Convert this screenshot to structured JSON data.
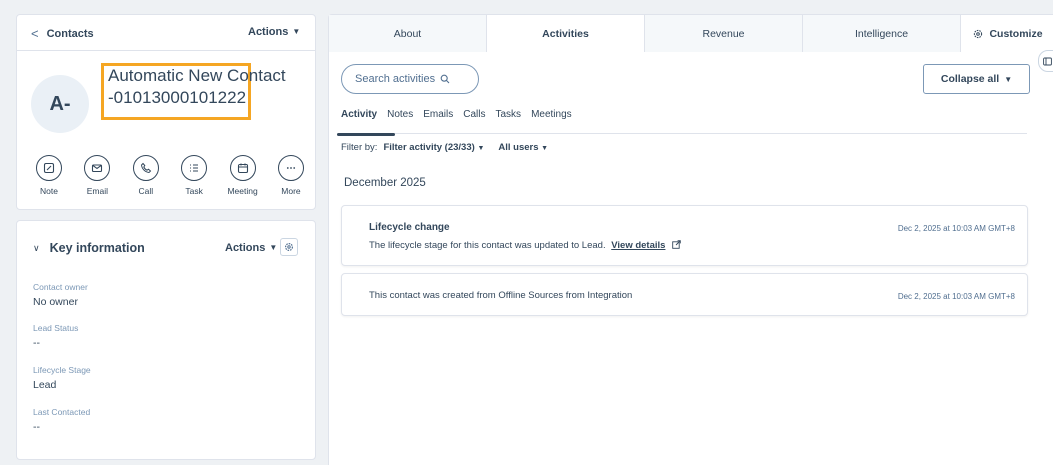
{
  "contact_card": {
    "back_label": "Contacts",
    "actions_label": "Actions",
    "avatar_initials": "A-",
    "name": "Automatic New Contact -01013000101222",
    "quick_actions": [
      "Note",
      "Email",
      "Call",
      "Task",
      "Meeting",
      "More"
    ]
  },
  "key_info": {
    "title": "Key information",
    "actions_label": "Actions",
    "properties": [
      {
        "label": "Contact owner",
        "value": "No owner"
      },
      {
        "label": "Lead Status",
        "value": "--"
      },
      {
        "label": "Lifecycle Stage",
        "value": "Lead"
      },
      {
        "label": "Last Contacted",
        "value": "--"
      }
    ]
  },
  "tabs": [
    "About",
    "Activities",
    "Revenue",
    "Intelligence"
  ],
  "customize_label": "Customize",
  "activities": {
    "search_placeholder": "Search activities",
    "collapse_label": "Collapse all",
    "subtabs": [
      "Activity",
      "Notes",
      "Emails",
      "Calls",
      "Tasks",
      "Meetings"
    ],
    "filter_prefix": "Filter by:",
    "filter_activity": "Filter activity (23/33)",
    "filter_users": "All users",
    "month": "December 2025",
    "items": [
      {
        "title": "Lifecycle change",
        "body": "The lifecycle stage for this contact was updated to Lead.",
        "link": "View details",
        "time": "Dec 2, 2025 at 10:03 AM GMT+8"
      },
      {
        "body": "This contact was created from Offline Sources from Integration",
        "time": "Dec 2, 2025 at 10:03 AM GMT+8"
      }
    ]
  },
  "colors": {
    "text": "#33475b",
    "border": "#dfe3eb",
    "highlight": "#f5a623",
    "background": "#eef1f4"
  }
}
